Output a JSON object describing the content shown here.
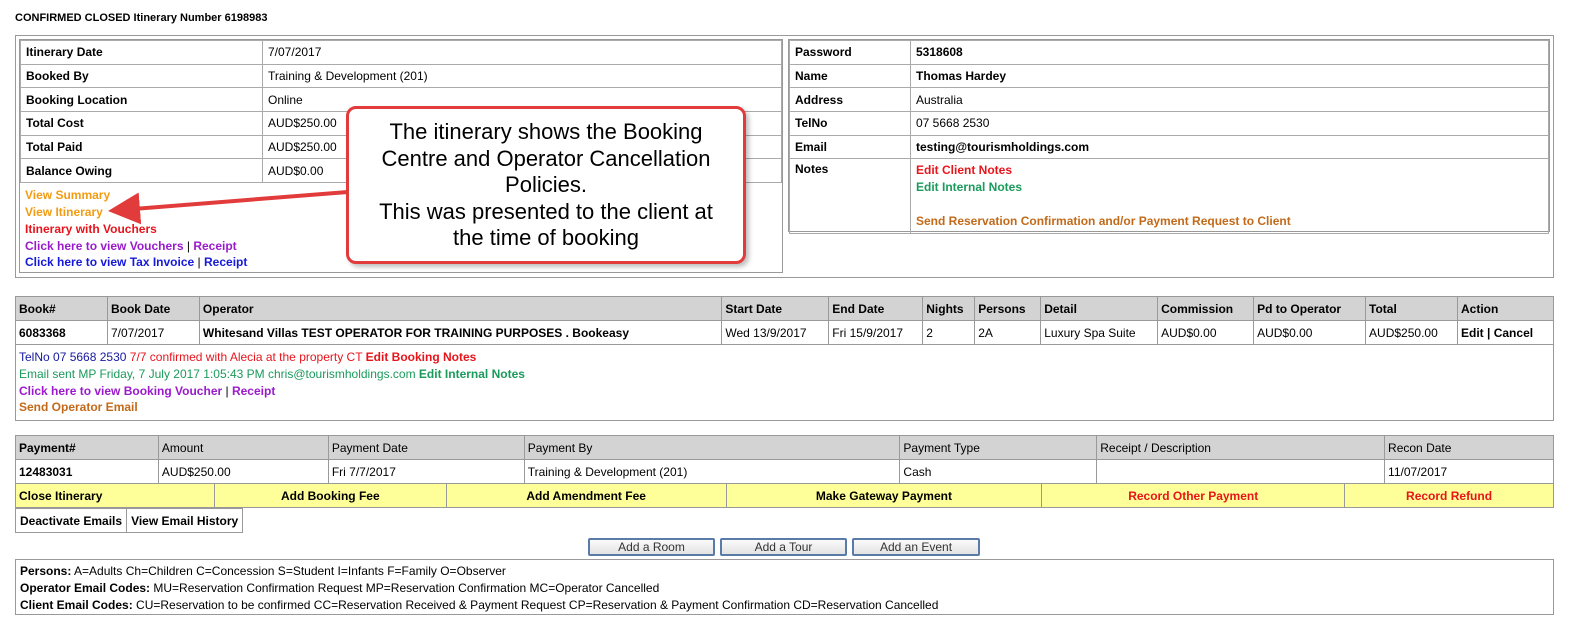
{
  "page_title": "CONFIRMED CLOSED Itinerary Number 6198983",
  "itinerary": [
    {
      "k": "Itinerary Date",
      "v": "7/07/2017"
    },
    {
      "k": "Booked By",
      "v": "Training & Development (201)"
    },
    {
      "k": "Booking Location",
      "v": "Online"
    },
    {
      "k": "Total Cost",
      "v": "AUD$250.00"
    },
    {
      "k": "Total Paid",
      "v": "AUD$250.00"
    },
    {
      "k": "Balance Owing",
      "v": "AUD$0.00"
    }
  ],
  "links": {
    "view_summary": "View Summary",
    "view_itinerary": "View Itinerary",
    "itinerary_vouchers": "Itinerary with Vouchers",
    "view_vouchers": "Click here to view Vouchers",
    "receipt": "Receipt",
    "view_tax_invoice": "Click here to view Tax Invoice",
    "sep": "|"
  },
  "client": [
    {
      "k": "Password",
      "v": "5318608"
    },
    {
      "k": "Name",
      "v": "Thomas Hardey"
    },
    {
      "k": "Address",
      "v": "Australia"
    },
    {
      "k": "TelNo",
      "v": "07 5668 2530"
    },
    {
      "k": "Email",
      "v": "testing@tourismholdings.com"
    }
  ],
  "notes": {
    "label": "Notes",
    "edit_client": "Edit Client Notes",
    "edit_internal": "Edit Internal Notes",
    "send_confirmation": "Send Reservation Confirmation and/or Payment Request to Client"
  },
  "bookings": {
    "headers": [
      "Book#",
      "Book Date",
      "Operator",
      "Start Date",
      "End Date",
      "Nights",
      "Persons",
      "Detail",
      "Commission",
      "Pd to Operator",
      "Total",
      "Action"
    ],
    "row": {
      "book_no": "6083368",
      "book_date": "7/07/2017",
      "operator": "Whitesand Villas TEST OPERATOR FOR TRAINING PURPOSES . Bookeasy",
      "start": "Wed 13/9/2017",
      "end": "Fri 15/9/2017",
      "nights": "2",
      "persons": "2A",
      "detail": "Luxury Spa Suite",
      "commission": "AUD$0.00",
      "pd_operator": "AUD$0.00",
      "total": "AUD$250.00",
      "edit": "Edit",
      "cancel": "Cancel",
      "sep": "|"
    },
    "notes": {
      "tel": "TelNo 07 5668 2530",
      "confirmed": "7/7 confirmed with Alecia at the property CT",
      "edit_booking_notes": "Edit Booking Notes",
      "email_sent": "Email sent MP Friday, 7 July 2017 1:05:43 PM chris@tourismholdings.com",
      "edit_internal": "Edit Internal Notes",
      "view_voucher": "Click here to view Booking Voucher",
      "receipt": "Receipt",
      "send_operator_email": "Send Operator Email"
    }
  },
  "payments": {
    "headers": [
      "Payment#",
      "Amount",
      "Payment Date",
      "Payment By",
      "Payment Type",
      "Receipt / Description",
      "Recon Date"
    ],
    "row": {
      "no": "12483031",
      "amount": "AUD$250.00",
      "date": "Fri 7/7/2017",
      "by": "Training & Development (201)",
      "type": "Cash",
      "desc": "",
      "recon": "11/07/2017"
    }
  },
  "actions": {
    "close": "Close Itinerary",
    "booking_fee": "Add Booking Fee",
    "amendment_fee": "Add Amendment Fee",
    "gateway": "Make Gateway Payment",
    "other_payment": "Record Other Payment",
    "refund": "Record Refund"
  },
  "email_buttons": {
    "deactivate": "Deactivate Emails",
    "history": "View Email History"
  },
  "add_buttons": {
    "room": "Add a Room",
    "tour": "Add a Tour",
    "event": "Add an Event"
  },
  "legend": {
    "persons_label": "Persons:",
    "persons": "A=Adults Ch=Children C=Concession S=Student I=Infants F=Family O=Observer",
    "operator_label": "Operator Email Codes:",
    "operator": "MU=Reservation Confirmation Request MP=Reservation Confirmation MC=Operator Cancelled",
    "client_label": "Client Email Codes:",
    "client": "CU=Reservation to be confirmed CC=Reservation Received & Payment Request CP=Reservation & Payment Confirmation CD=Reservation Cancelled"
  },
  "callout": {
    "line1": "The itinerary shows the Booking",
    "line2": "Centre and Operator Cancellation",
    "line3": "Policies.",
    "line4": "This was presented to the client at",
    "line5": "the time of booking"
  },
  "colors": {
    "header_bg": "#d3d3d3",
    "action_bar_bg": "#ffff99",
    "callout_border": "#e23b3b"
  }
}
